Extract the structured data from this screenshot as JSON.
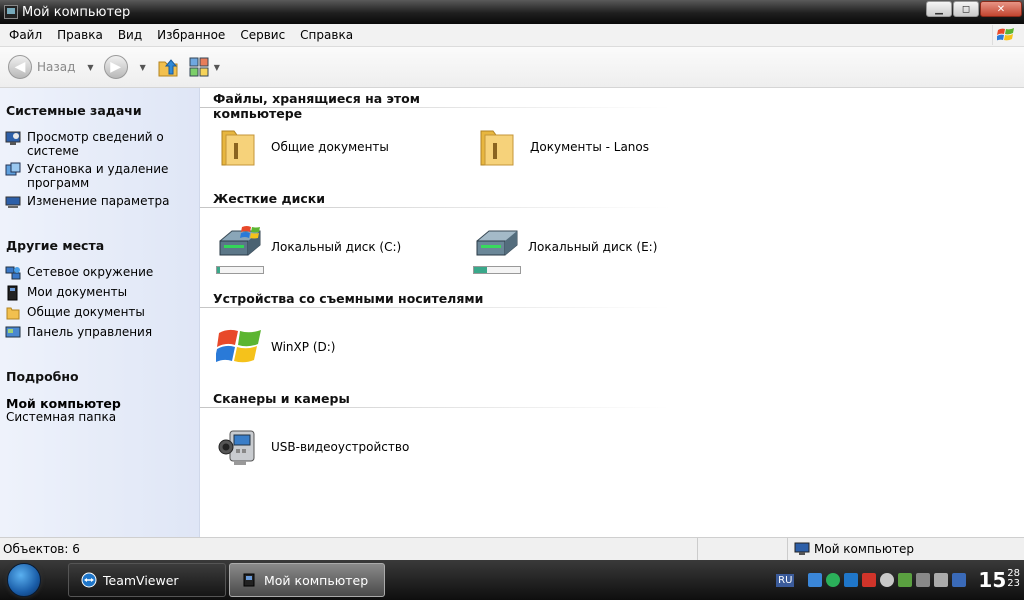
{
  "window": {
    "title": "Мой компьютер",
    "buttons": {
      "minimize": "▁",
      "maximize": "◻",
      "close": "✕"
    }
  },
  "menu": [
    "Файл",
    "Правка",
    "Вид",
    "Избранное",
    "Сервис",
    "Справка"
  ],
  "toolbar": {
    "back_label": "Назад"
  },
  "sidebar": {
    "system_tasks": {
      "title": "Системные задачи",
      "items": [
        {
          "label": "Просмотр сведений о системе",
          "icon": "system-info-icon"
        },
        {
          "label": "Установка и удаление программ",
          "icon": "add-remove-programs-icon"
        },
        {
          "label": "Изменение параметра",
          "icon": "change-setting-icon"
        }
      ]
    },
    "other_places": {
      "title": "Другие места",
      "items": [
        {
          "label": "Сетевое окружение",
          "icon": "network-icon"
        },
        {
          "label": "Мои документы",
          "icon": "my-documents-icon"
        },
        {
          "label": "Общие документы",
          "icon": "shared-documents-icon"
        },
        {
          "label": "Панель управления",
          "icon": "control-panel-icon"
        }
      ]
    },
    "details": {
      "title": "Подробно",
      "name": "Мой компьютер",
      "description": "Системная папка"
    }
  },
  "content": {
    "sections": [
      {
        "title": "Файлы, хранящиеся на этом компьютере",
        "items": [
          {
            "label": "Общие документы",
            "icon": "folder-icon"
          },
          {
            "label": "Документы - Lanos",
            "icon": "folder-icon"
          }
        ]
      },
      {
        "title": "Жесткие диски",
        "items": [
          {
            "label": "Локальный диск (C:)",
            "icon": "hard-drive-windows-icon",
            "used_fraction": 0.06
          },
          {
            "label": "Локальный диск (E:)",
            "icon": "hard-drive-icon",
            "used_fraction": 0.28
          }
        ]
      },
      {
        "title": "Устройства со съемными носителями",
        "items": [
          {
            "label": "WinXP (D:)",
            "icon": "windows-cd-icon"
          }
        ]
      },
      {
        "title": "Сканеры и камеры",
        "items": [
          {
            "label": "USB-видеоустройство",
            "icon": "camcorder-icon"
          }
        ]
      }
    ]
  },
  "statusbar": {
    "objects": "Объектов: 6",
    "location": "Мой компьютер"
  },
  "taskbar": {
    "buttons": [
      {
        "label": "TeamViewer",
        "icon": "teamviewer-icon"
      },
      {
        "label": "Мой компьютер",
        "icon": "my-computer-icon",
        "active": true
      }
    ],
    "tray": {
      "language": "RU"
    },
    "clock": {
      "hours": "15",
      "minutes": "28",
      "seconds": "23"
    }
  },
  "colors": {
    "sidebar_bg": "#e3e9f7",
    "progress_fill": "#3aa88a",
    "titlebar_bg": "#1e1e1e"
  }
}
